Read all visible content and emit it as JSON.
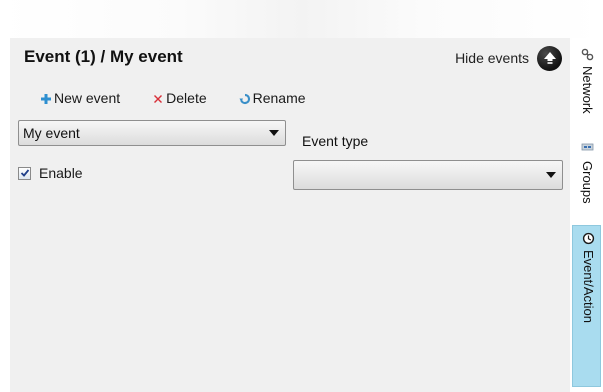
{
  "panel": {
    "title": "Event (1) / My event",
    "hide_events_label": "Hide events"
  },
  "toolbar": {
    "new_event_label": "New event",
    "delete_label": "Delete",
    "rename_label": "Rename"
  },
  "event_select": {
    "value": "My event"
  },
  "event_type": {
    "label": "Event type",
    "value": ""
  },
  "enable": {
    "label": "Enable",
    "checked": true
  },
  "side_tabs": [
    {
      "label": "Network",
      "icon": "network-icon",
      "active": false
    },
    {
      "label": "Groups",
      "icon": "groups-icon",
      "active": false
    },
    {
      "label": "Event/Action",
      "icon": "clock-icon",
      "active": true
    }
  ],
  "colors": {
    "panel_bg": "#f0f0f0",
    "active_tab": "#a9dcef"
  }
}
